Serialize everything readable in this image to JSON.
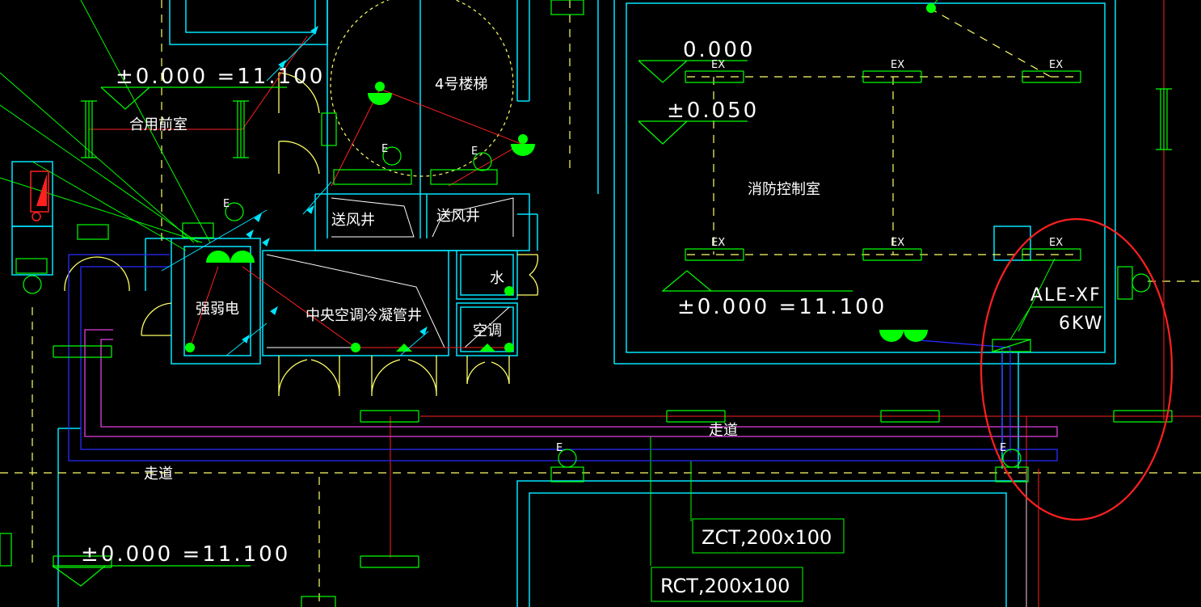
{
  "drawing": {
    "colors": {
      "background": "#000000",
      "wall": "#00e5ff",
      "door": "#ffff66",
      "hidden": "#ffff66",
      "green": "#00ff00",
      "red": "#ff2020",
      "magenta": "#e040e0",
      "blue": "#2a2aff",
      "highlight": "#ff2020",
      "text": "#ffffff"
    },
    "elevations": {
      "top_left": "±0.000 =11.100",
      "room_right_1": "0.000",
      "room_right_2": "±0.050",
      "room_right_3": "±0.000 =11.100",
      "bottom_left": "±0.000 =11.100"
    },
    "rooms": {
      "shared_lobby": "合用前室",
      "stair_4": "4号楼梯",
      "fire_control": "消防控制室",
      "supply_shaft_1": "送风井",
      "supply_shaft_2": "送风井",
      "weak_strong_elec": "强弱电",
      "hvac_condensate_shaft": "中央空调冷凝管井",
      "water": "水",
      "ac": "空调",
      "corridor_1": "走道",
      "corridor_2": "走道"
    },
    "equipment": {
      "exhaust_label": "EX",
      "panel_name": "ALE-XF",
      "panel_power": "6KW",
      "emergency_letter": "E"
    },
    "ducts": {
      "zct": "ZCT,200x100",
      "rct": "RCT,200x100"
    }
  }
}
